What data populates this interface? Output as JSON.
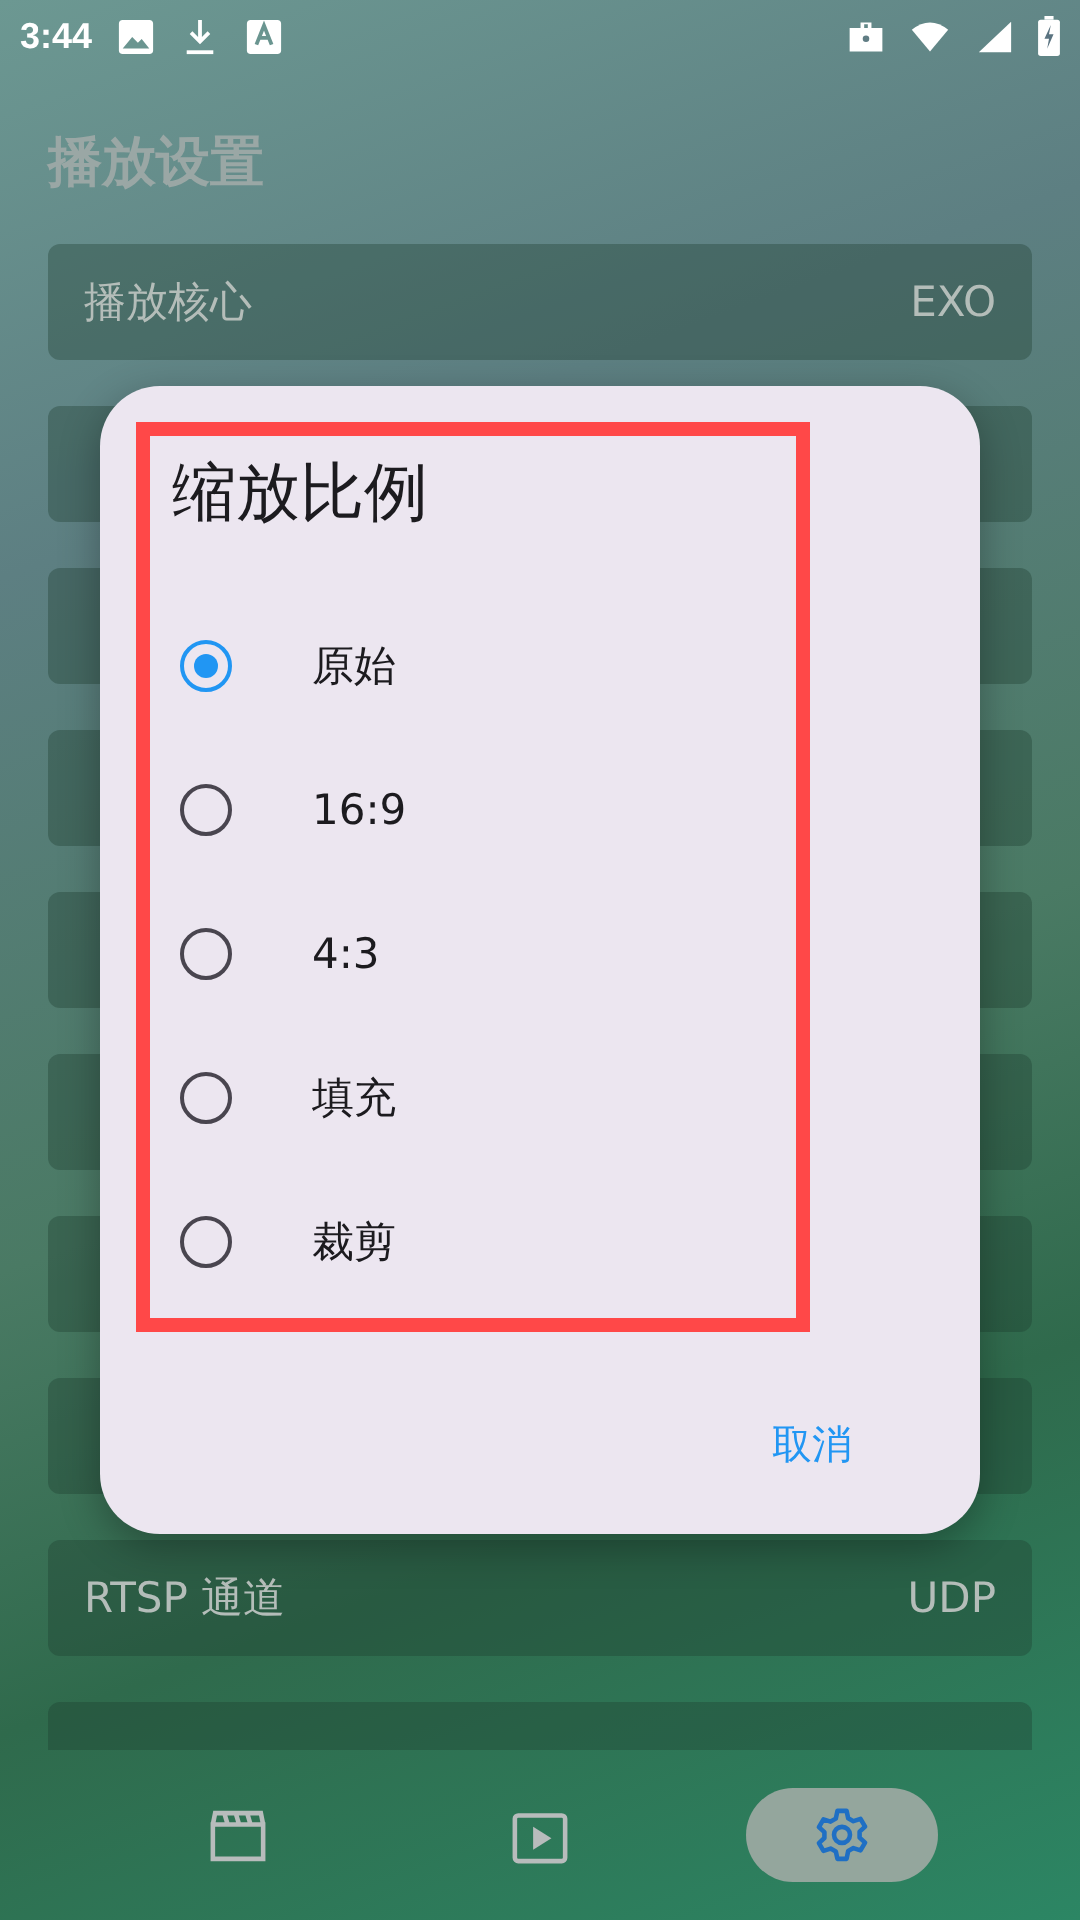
{
  "status_bar": {
    "time": "3:44"
  },
  "page_title": "播放设置",
  "settings": [
    {
      "kind": "full",
      "label": "播放核心",
      "value": "EXO"
    },
    {
      "kind": "covered"
    },
    {
      "kind": "covered"
    },
    {
      "kind": "covered"
    },
    {
      "kind": "covered"
    },
    {
      "kind": "covered"
    },
    {
      "kind": "covered"
    },
    {
      "kind": "covered"
    },
    {
      "kind": "full",
      "label": "RTSP 通道",
      "value": "UDP"
    },
    {
      "kind": "covered"
    }
  ],
  "dialog": {
    "title": "缩放比例",
    "options": [
      {
        "label": "原始",
        "selected": true
      },
      {
        "label": "16:9",
        "selected": false
      },
      {
        "label": "4:3",
        "selected": false
      },
      {
        "label": "填充",
        "selected": false
      },
      {
        "label": "裁剪",
        "selected": false
      }
    ],
    "cancel": "取消"
  },
  "nav": [
    {
      "kind": "clapper",
      "selected": false
    },
    {
      "kind": "play",
      "selected": false
    },
    {
      "kind": "gear",
      "selected": true
    }
  ]
}
